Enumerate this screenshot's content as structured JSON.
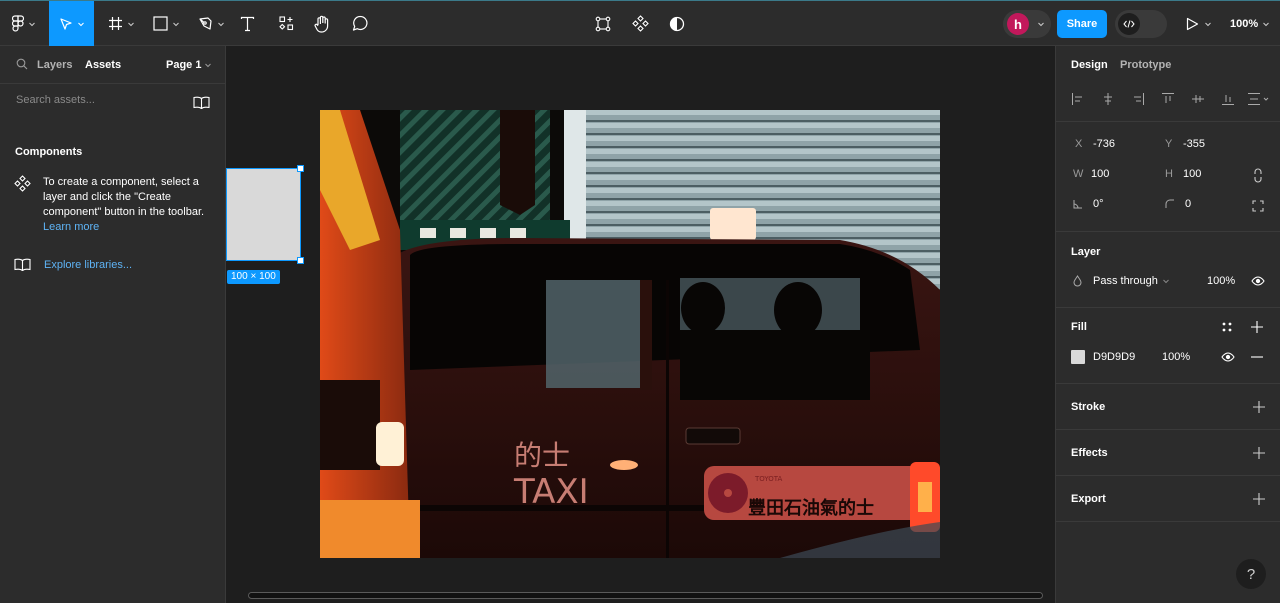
{
  "toolbar": {
    "tools": [
      {
        "name": "main-menu",
        "icon": "figma-logo-icon",
        "has_dropdown": true
      },
      {
        "name": "move",
        "icon": "move-cursor-icon",
        "has_dropdown": true,
        "active": true
      },
      {
        "name": "frame",
        "icon": "frame-hash-icon",
        "has_dropdown": true
      },
      {
        "name": "shape",
        "icon": "rectangle-icon",
        "has_dropdown": true
      },
      {
        "name": "pen",
        "icon": "pen-icon",
        "has_dropdown": true
      },
      {
        "name": "text",
        "icon": "text-icon",
        "has_dropdown": false
      },
      {
        "name": "resources",
        "icon": "resources-icon",
        "has_dropdown": false
      },
      {
        "name": "hand",
        "icon": "hand-icon",
        "has_dropdown": false
      },
      {
        "name": "comment",
        "icon": "comment-icon",
        "has_dropdown": false
      }
    ],
    "center_tools": [
      "edit-object-icon",
      "create-component-icon",
      "mask-contrast-icon"
    ],
    "user_initial": "h",
    "user_color": "#c2185b",
    "share_label": "Share",
    "dev_mode_icon": "code-icon",
    "present_icon": "play-icon",
    "zoom_level": "100%",
    "accent_color": "#0d99ff"
  },
  "left_panel": {
    "tabs": {
      "layers": "Layers",
      "assets": "Assets"
    },
    "active_tab": "Assets",
    "page_selector": "Page 1",
    "search_placeholder": "Search assets...",
    "components_heading": "Components",
    "components_help": "To create a component, select a layer and click the \"Create component\" button in the toolbar.",
    "learn_more": "Learn more",
    "explore_libraries": "Explore libraries..."
  },
  "canvas": {
    "selected_rect_fill": "#d9d9d9",
    "size_badge": "100 × 100",
    "photo": {
      "description": "Red Hong Kong taxi at night in front of a metal roller shutter",
      "door_text_chinese": "的士",
      "door_text": "TAXI",
      "ad_brand": "TOYOTA",
      "ad_text": "豐田石油氣的士"
    }
  },
  "right_panel": {
    "tabs": {
      "design": "Design",
      "prototype": "Prototype"
    },
    "active_tab": "Design",
    "position": {
      "x_label": "X",
      "x": "-736",
      "y_label": "Y",
      "y": "-355"
    },
    "size": {
      "w_label": "W",
      "w": "100",
      "h_label": "H",
      "h": "100"
    },
    "rotation": "0°",
    "corner_radius": "0",
    "layer": {
      "title": "Layer",
      "blend_mode": "Pass through",
      "opacity": "100%"
    },
    "fill": {
      "title": "Fill",
      "hex": "D9D9D9",
      "swatch": "#d9d9d9",
      "opacity": "100%"
    },
    "stroke": {
      "title": "Stroke"
    },
    "effects": {
      "title": "Effects"
    },
    "export": {
      "title": "Export"
    },
    "help_label": "?"
  }
}
